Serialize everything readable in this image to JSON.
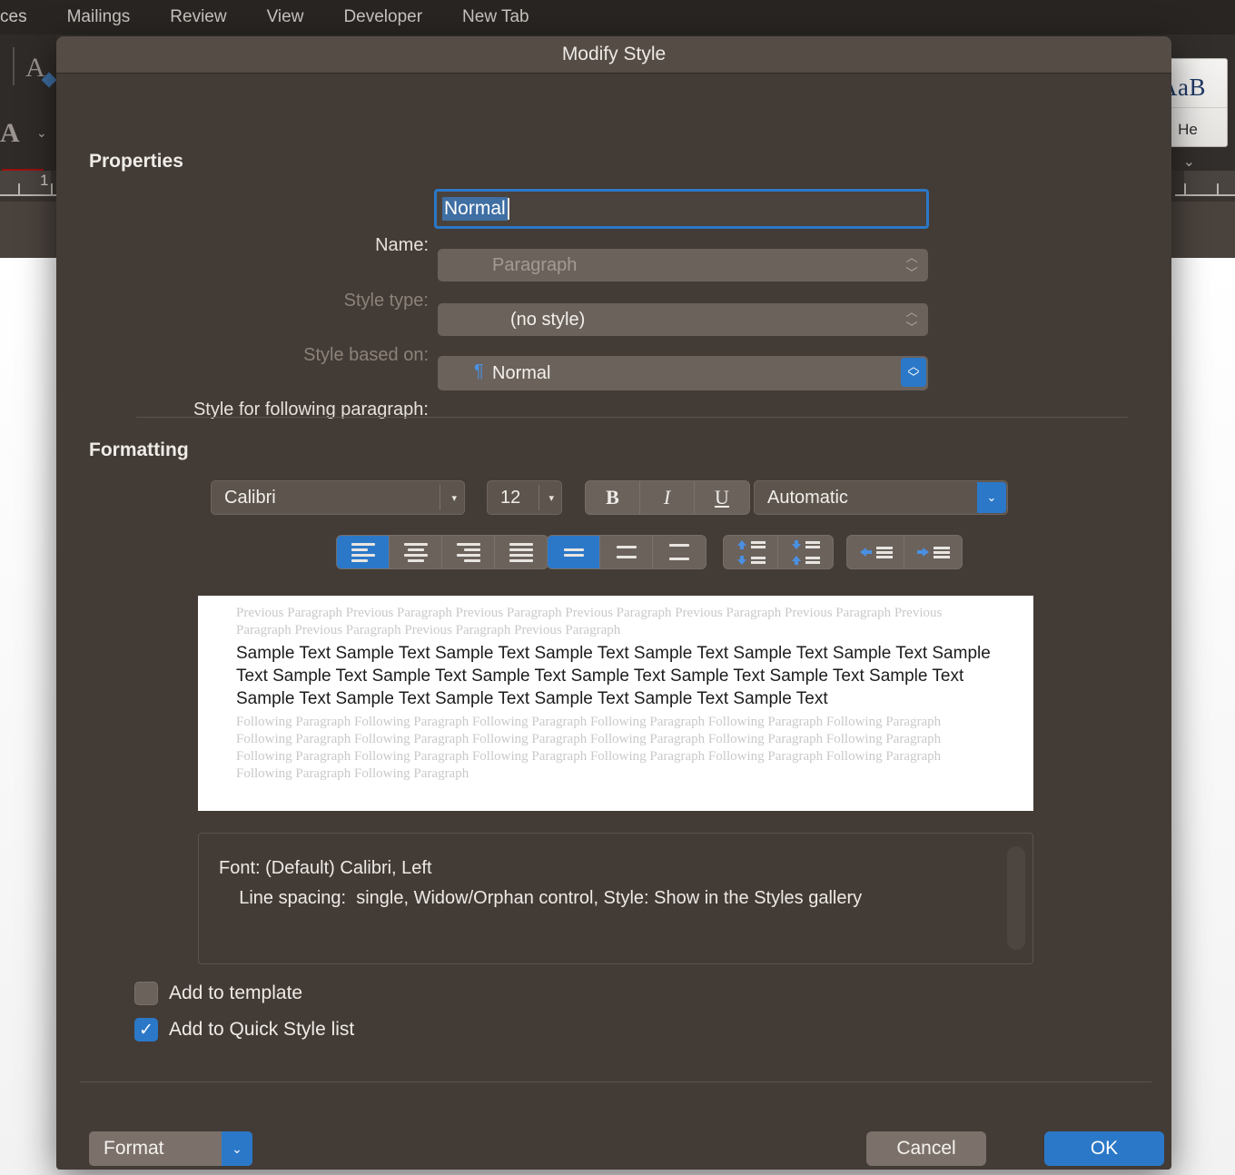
{
  "background": {
    "ribbon_tabs": [
      "ces",
      "Mailings",
      "Review",
      "View",
      "Developer",
      "New Tab"
    ],
    "left_tools": {
      "text_effects_icon": "A-effects-icon",
      "font_color_icon": "A-font-color-icon",
      "font_color_swatch": "#9c1111"
    },
    "style_gallery": {
      "preview": "AaB",
      "label": "He"
    },
    "ruler_number": "1"
  },
  "dialog": {
    "title": "Modify Style",
    "properties": {
      "heading": "Properties",
      "name_label": "Name:",
      "name_value": "Normal",
      "style_type_label": "Style type:",
      "style_type_value": "Paragraph",
      "style_based_on_label": "Style based on:",
      "style_based_on_value": "(no style)",
      "following_label": "Style for following paragraph:",
      "following_value": "Normal",
      "following_glyph": "¶"
    },
    "formatting": {
      "heading": "Formatting",
      "font_family": "Calibri",
      "font_size": "12",
      "bold_label": "B",
      "italic_label": "I",
      "underline_label": "U",
      "font_color": "Automatic",
      "align_buttons": [
        "align-left",
        "align-center",
        "align-right",
        "align-justify"
      ],
      "align_active_index": 0,
      "line_spacing_buttons": [
        "line-spacing-single",
        "line-spacing-1_5",
        "line-spacing-double"
      ],
      "line_spacing_active_index": 0,
      "space_buttons": [
        "remove-space-before",
        "add-space-after"
      ],
      "indent_buttons": [
        "decrease-indent",
        "increase-indent"
      ]
    },
    "preview": {
      "previous_paragraph": "Previous Paragraph Previous Paragraph Previous Paragraph Previous Paragraph Previous Paragraph Previous Paragraph Previous Paragraph Previous Paragraph Previous Paragraph Previous Paragraph",
      "sample_text": "Sample Text Sample Text Sample Text Sample Text Sample Text Sample Text Sample Text Sample Text Sample Text Sample Text Sample Text Sample Text Sample Text Sample Text Sample Text Sample Text Sample Text Sample Text Sample Text Sample Text Sample Text",
      "following_paragraph": "Following Paragraph Following Paragraph Following Paragraph Following Paragraph Following Paragraph Following Paragraph Following Paragraph Following Paragraph Following Paragraph Following Paragraph Following Paragraph Following Paragraph Following Paragraph Following Paragraph Following Paragraph Following Paragraph Following Paragraph Following Paragraph Following Paragraph Following Paragraph"
    },
    "description": "Font: (Default) Calibri, Left\n    Line spacing:  single, Widow/Orphan control, Style: Show in the Styles gallery",
    "checkboxes": [
      {
        "label": "Add to template",
        "checked": false
      },
      {
        "label": "Add to Quick Style list",
        "checked": true
      }
    ],
    "footer": {
      "format_label": "Format",
      "cancel_label": "Cancel",
      "ok_label": "OK"
    }
  },
  "colors": {
    "accent": "#2b78c8",
    "dialog_bg": "#433b36",
    "titlebar_bg": "#564c46",
    "control_bg": "#6b625c"
  }
}
